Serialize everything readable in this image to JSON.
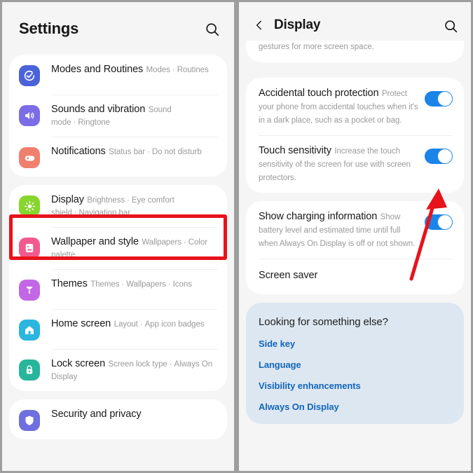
{
  "theme": {
    "page_background": "#9e9e9e",
    "panel_background": "#f5f5f5",
    "card_background": "#ffffff",
    "accent_toggle_on": "#1a84e8",
    "highlight_box_color": "#e8121a",
    "arrow_color": "#e8121a",
    "link_color": "#1266bb",
    "lookfor_background": "#dde7f1"
  },
  "left_panel": {
    "header": {
      "title": "Settings",
      "search_icon": "search-icon"
    },
    "groups": [
      {
        "items": [
          {
            "icon": "modes-and-routines-icon",
            "icon_color": "#4b63d8",
            "title": "Modes and Routines",
            "subtitle_parts": [
              "Modes",
              "Routines"
            ]
          },
          {
            "icon": "sounds-and-vibration-icon",
            "icon_color": "#7b6ce8",
            "title": "Sounds and vibration",
            "subtitle_parts": [
              "Sound mode",
              "Ringtone"
            ]
          },
          {
            "icon": "notifications-icon",
            "icon_color": "#f07f6e",
            "title": "Notifications",
            "subtitle_parts": [
              "Status bar",
              "Do not disturb"
            ]
          }
        ]
      },
      {
        "items": [
          {
            "icon": "display-icon",
            "icon_color": "#86d62b",
            "title": "Display",
            "subtitle_parts": [
              "Brightness",
              "Eye comfort shield",
              "Navigation bar"
            ],
            "highlighted": true
          },
          {
            "icon": "wallpaper-and-style-icon",
            "icon_color": "#f25a8e",
            "title": "Wallpaper and style",
            "subtitle_parts": [
              "Wallpapers",
              "Color palette"
            ]
          },
          {
            "icon": "themes-icon",
            "icon_color": "#c268e6",
            "title": "Themes",
            "subtitle_parts": [
              "Themes",
              "Wallpapers",
              "Icons"
            ]
          },
          {
            "icon": "home-screen-icon",
            "icon_color": "#2ab6df",
            "title": "Home screen",
            "subtitle_parts": [
              "Layout",
              "App icon badges"
            ]
          },
          {
            "icon": "lock-screen-icon",
            "icon_color": "#27b59b",
            "title": "Lock screen",
            "subtitle_parts": [
              "Screen lock type",
              "Always On Display"
            ]
          }
        ]
      },
      {
        "items": [
          {
            "icon": "security-and-privacy-icon",
            "icon_color": "#6f6fe0",
            "title": "Security and privacy",
            "subtitle_parts": []
          }
        ]
      }
    ]
  },
  "right_panel": {
    "header": {
      "back_icon": "back-chevron-icon",
      "title": "Display",
      "search_icon": "search-icon"
    },
    "partial_card_text": "gestures for more screen space.",
    "settings": [
      {
        "title": "Accidental touch protection",
        "subtitle": "Protect your phone from accidental touches when it's in a dark place, such as a pocket or bag.",
        "toggle": "on"
      },
      {
        "title": "Touch sensitivity",
        "subtitle": "Increase the touch sensitivity of the screen for use with screen protectors.",
        "toggle": "on"
      }
    ],
    "settings2": [
      {
        "title": "Show charging information",
        "subtitle": "Show battery level and estimated time until full when Always On Display is off or not shown.",
        "toggle": "on"
      },
      {
        "title": "Screen saver",
        "subtitle": "",
        "toggle": "none"
      }
    ],
    "looking_for": {
      "title": "Looking for something else?",
      "links": [
        "Side key",
        "Language",
        "Visibility enhancements",
        "Always On Display"
      ]
    }
  },
  "annotations": {
    "arrow": {
      "name": "red-arrow-pointer",
      "points_to": "Touch sensitivity toggle"
    },
    "highlight": {
      "name": "red-highlight-box",
      "surrounds": "Display"
    }
  }
}
